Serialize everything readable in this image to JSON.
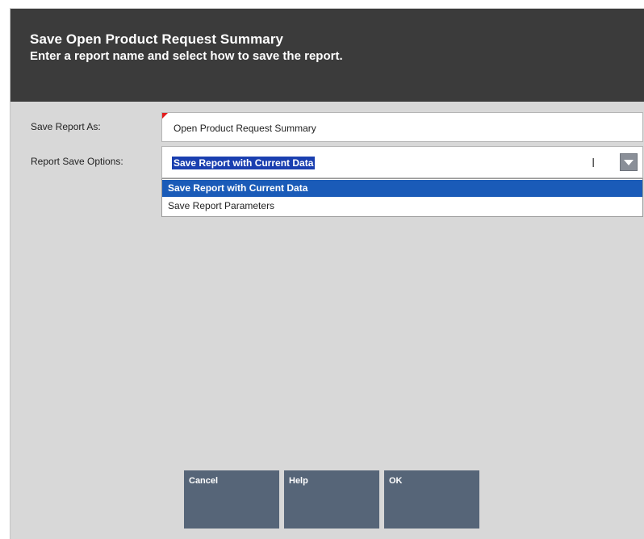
{
  "header": {
    "title": "Save Open Product Request Summary",
    "subtitle": "Enter a report name and select how to save the report."
  },
  "form": {
    "save_as_label": "Save Report As:",
    "save_as_value": "Open Product Request Summary",
    "options_label": "Report Save Options:",
    "selected_option": "Save Report with Current Data",
    "options": [
      "Save Report with Current Data",
      "Save Report Parameters"
    ]
  },
  "buttons": {
    "cancel": "Cancel",
    "help": "Help",
    "ok": "OK"
  },
  "colors": {
    "header_bg": "#3b3b3b",
    "panel_bg": "#d8d8d8",
    "button_bg": "#566578",
    "highlight": "#1a5bb8",
    "required_mark": "#e31b1b"
  },
  "icons": {
    "dropdown": "chevron-down-icon",
    "text_cursor": "i-beam-cursor-icon",
    "required": "required-field-marker-icon"
  }
}
